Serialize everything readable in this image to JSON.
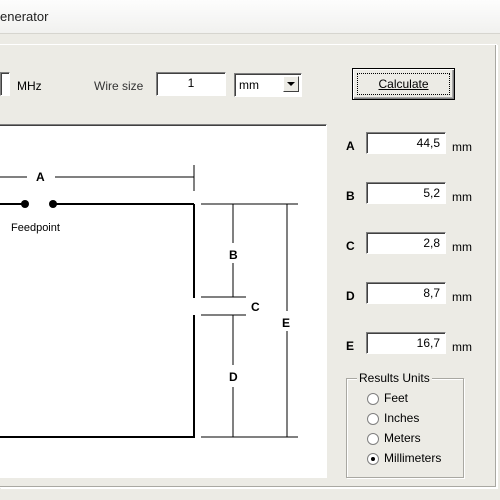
{
  "window": {
    "title": "enerator"
  },
  "toolbar": {
    "freq_unit": "MHz",
    "wire_size_label": "Wire size",
    "wire_size_value": "1",
    "wire_unit": "mm",
    "calculate_label": "Calculate"
  },
  "diagram": {
    "label_a": "A",
    "label_b": "B",
    "label_c": "C",
    "label_d": "D",
    "label_e": "E",
    "feedpoint": "Feedpoint"
  },
  "results": [
    {
      "key": "A",
      "value": "44,5",
      "unit": "mm"
    },
    {
      "key": "B",
      "value": "5,2",
      "unit": "mm"
    },
    {
      "key": "C",
      "value": "2,8",
      "unit": "mm"
    },
    {
      "key": "D",
      "value": "8,7",
      "unit": "mm"
    },
    {
      "key": "E",
      "value": "16,7",
      "unit": "mm"
    }
  ],
  "units_group": {
    "title": "Results Units",
    "options": [
      "Feet",
      "Inches",
      "Meters",
      "Millimeters"
    ],
    "selected": "Millimeters"
  }
}
